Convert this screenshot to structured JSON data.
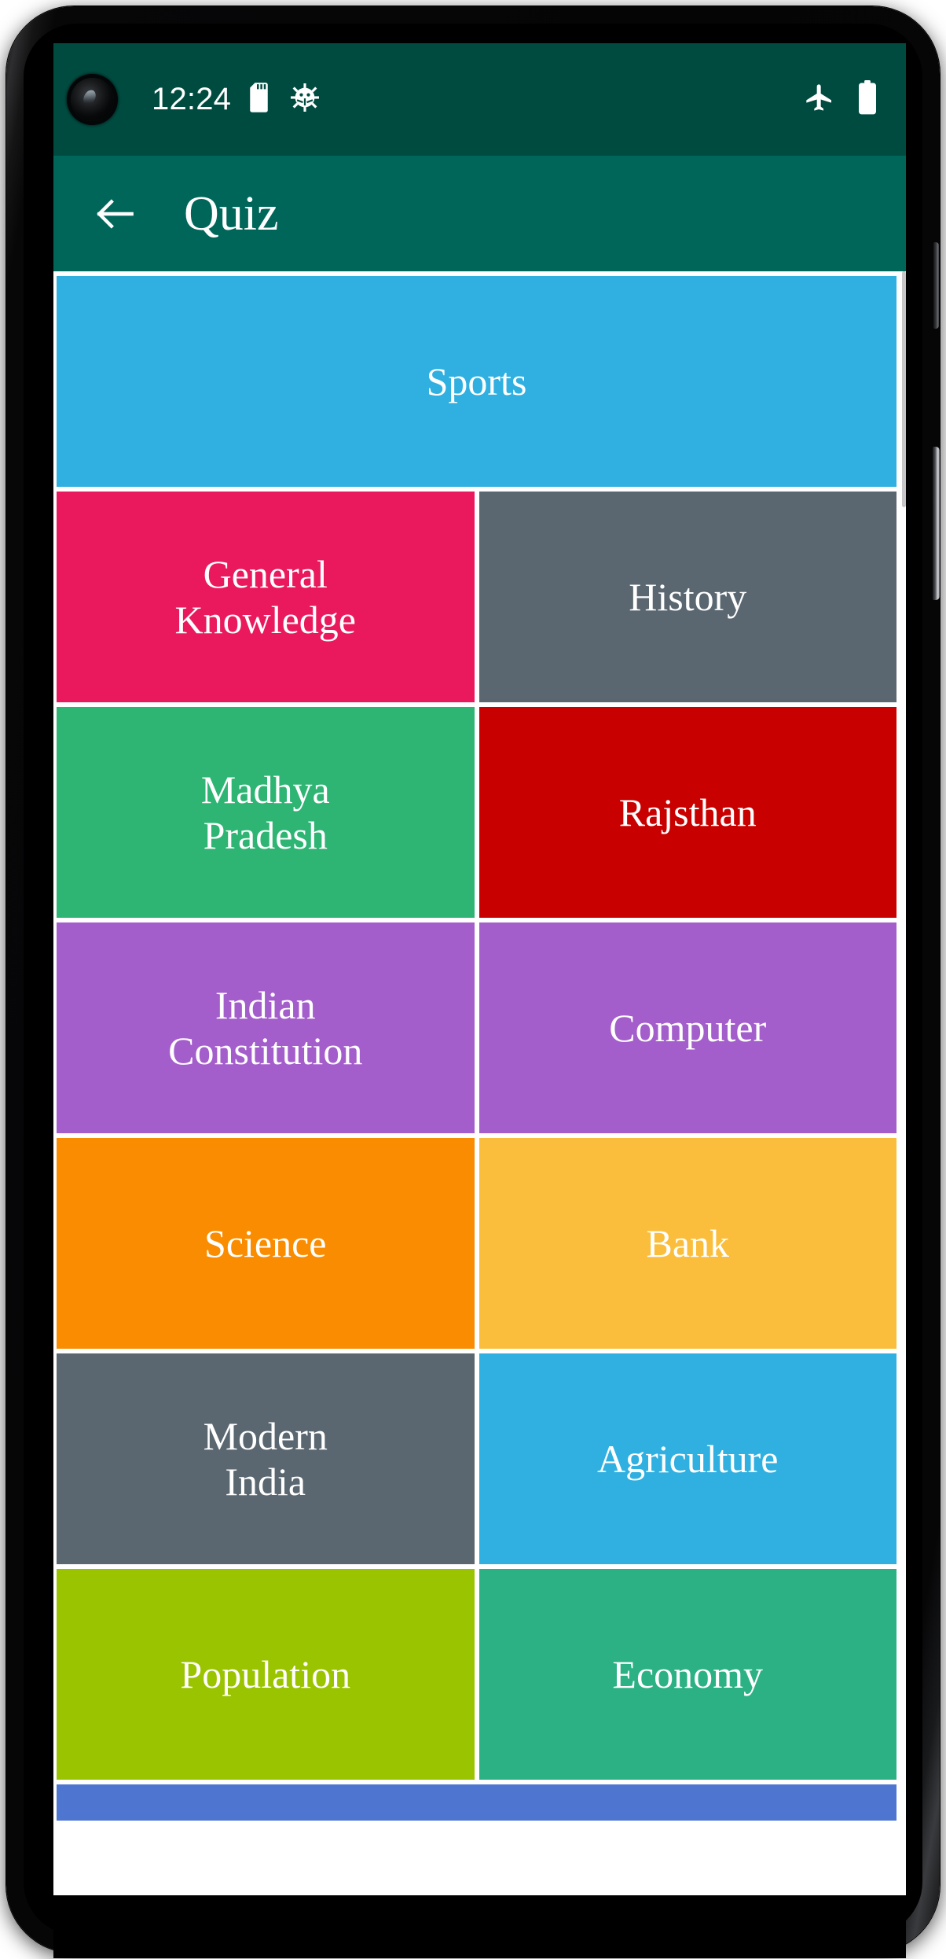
{
  "device": {
    "platform": "android",
    "frame": "phone-mockup"
  },
  "status_bar": {
    "time": "12:24",
    "background_color": "#004b40",
    "foreground_color": "#ffffff",
    "left_icons": [
      {
        "name": "sd-card-icon",
        "label": "SD card"
      },
      {
        "name": "android-bug-icon",
        "label": "Debug"
      }
    ],
    "right_icons": [
      {
        "name": "airplane-mode-icon",
        "label": "Airplane mode"
      },
      {
        "name": "battery-icon",
        "label": "Battery full"
      }
    ]
  },
  "app_bar": {
    "title": "Quiz",
    "back_label": "Back",
    "background_color": "#00665a",
    "title_color": "#ffffff"
  },
  "grid": {
    "columns": 2,
    "tiles": [
      {
        "label": "Sports",
        "color": "#2fb0e0",
        "span": "full"
      },
      {
        "label": "General\nKnowledge",
        "color": "#ea195e",
        "span": "half"
      },
      {
        "label": "History",
        "color": "#5a6670",
        "span": "half"
      },
      {
        "label": "Madhya\nPradesh",
        "color": "#2eb473",
        "span": "half"
      },
      {
        "label": "Rajsthan",
        "color": "#c80000",
        "span": "half"
      },
      {
        "label": "Indian\nConstitution",
        "color": "#a45ecb",
        "span": "half"
      },
      {
        "label": "Computer",
        "color": "#a45ecb",
        "span": "half"
      },
      {
        "label": "Science",
        "color": "#f98c00",
        "span": "half"
      },
      {
        "label": "Bank",
        "color": "#fbbe3c",
        "span": "half"
      },
      {
        "label": "Modern\nIndia",
        "color": "#5a6670",
        "span": "half"
      },
      {
        "label": "Agriculture",
        "color": "#2fb0e0",
        "span": "half"
      },
      {
        "label": "Population",
        "color": "#9bc400",
        "span": "half"
      },
      {
        "label": "Economy",
        "color": "#2cb185",
        "span": "half"
      },
      {
        "label": "",
        "color": "#4e76d0",
        "span": "strip"
      }
    ]
  },
  "gesture_nav": {
    "pill_color": "#ededee"
  }
}
